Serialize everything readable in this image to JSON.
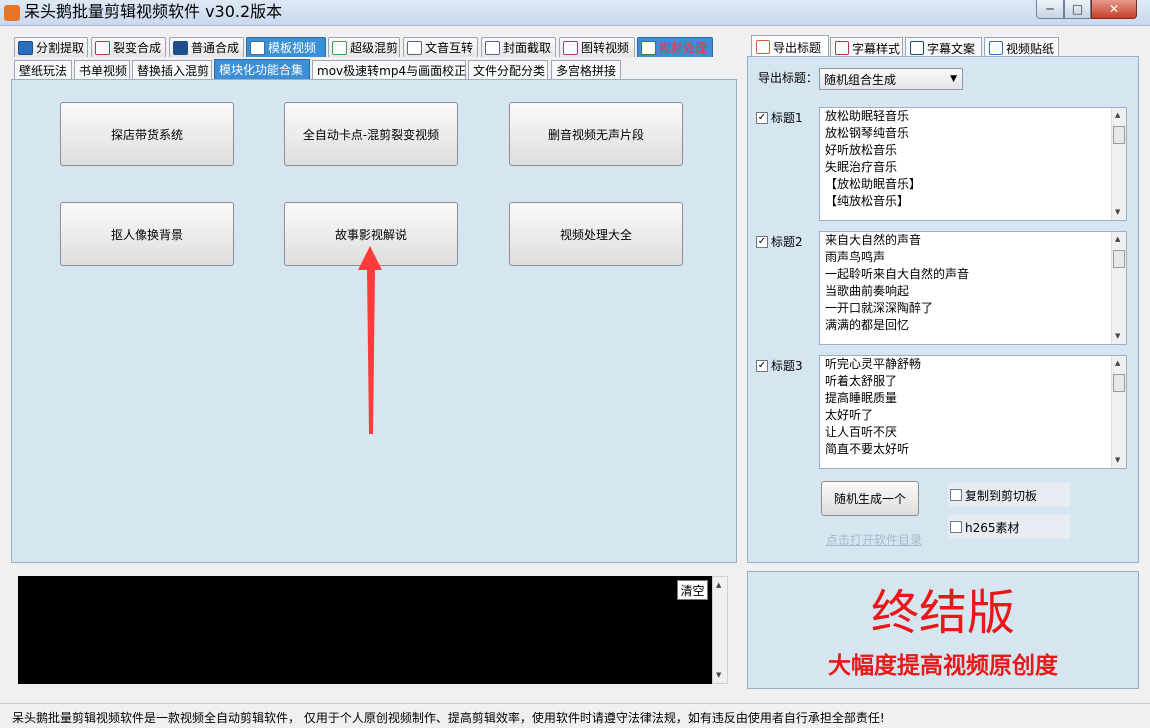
{
  "window": {
    "title": "呆头鹅批量剪辑视频软件   v30.2版本",
    "min": "─",
    "max": "□",
    "close": "✕"
  },
  "main_tabs": [
    {
      "label": "分割提取",
      "icon": "play-icon"
    },
    {
      "label": "裂变合成",
      "icon": "copy-icon"
    },
    {
      "label": "普通合成",
      "icon": "play-icon"
    },
    {
      "label": "模板视频",
      "icon": "template-icon"
    },
    {
      "label": "超级混剪",
      "icon": "audio-wave-icon"
    },
    {
      "label": "文音互转",
      "icon": "microphone-icon"
    },
    {
      "label": "封面截取",
      "icon": "image-icon"
    },
    {
      "label": "图转视频",
      "icon": "image-play-icon"
    },
    {
      "label": "视频处理",
      "icon": "video-process-icon"
    }
  ],
  "sub_tabs": [
    "壁纸玩法",
    "书单视频",
    "替换插入混剪",
    "模块化功能合集",
    "mov极速转mp4与画面校正",
    "文件分配分类",
    "多宫格拼接"
  ],
  "feature_buttons": [
    "探店带货系统",
    "全自动卡点-混剪裂变视频",
    "删音视频无声片段",
    "抠人像换背景",
    "故事影视解说",
    "视频处理大全"
  ],
  "right_tabs": [
    "导出标题",
    "字幕样式",
    "字幕文案",
    "视频贴纸"
  ],
  "export": {
    "label": "导出标题：",
    "mode": "随机组合生成",
    "titles": [
      {
        "label": "标题1",
        "checked": true,
        "lines": [
          "放松助眠轻音乐",
          "放松钢琴纯音乐",
          "好听放松音乐",
          "失眠治疗音乐",
          "【放松助眠音乐】",
          "【纯放松音乐】"
        ]
      },
      {
        "label": "标题2",
        "checked": true,
        "lines": [
          "来自大自然的声音",
          "雨声鸟鸣声",
          "一起聆听来自大自然的声音",
          "当歌曲前奏响起",
          "一开口就深深陶醉了",
          "满满的都是回忆"
        ]
      },
      {
        "label": "标题3",
        "checked": true,
        "lines": [
          "听完心灵平静舒畅",
          "听着太舒服了",
          "提高睡眠质量",
          "太好听了",
          "让人百听不厌",
          "简直不要太好听"
        ]
      }
    ],
    "generate_button": "随机生成一个",
    "copy_clipboard": "复制到剪切板",
    "h265": "h265素材",
    "open_dir_link": "点击打开软件目录"
  },
  "log": {
    "clear_button": "清空"
  },
  "promo": {
    "headline": "终结版",
    "subline": "大幅度提高视频原创度",
    "color": "#e81818"
  },
  "status_text": "呆头鹅批量剪辑视频软件是一款视频全自动剪辑软件， 仅用于个人原创视频制作、提高剪辑效率，使用软件时请遵守法律法规，如有违反由使用者自行承担全部责任!",
  "colors": {
    "panel": "#d6e6f0",
    "tab_selected": "#3b8fd6",
    "arrow": "#ff3b3b"
  }
}
